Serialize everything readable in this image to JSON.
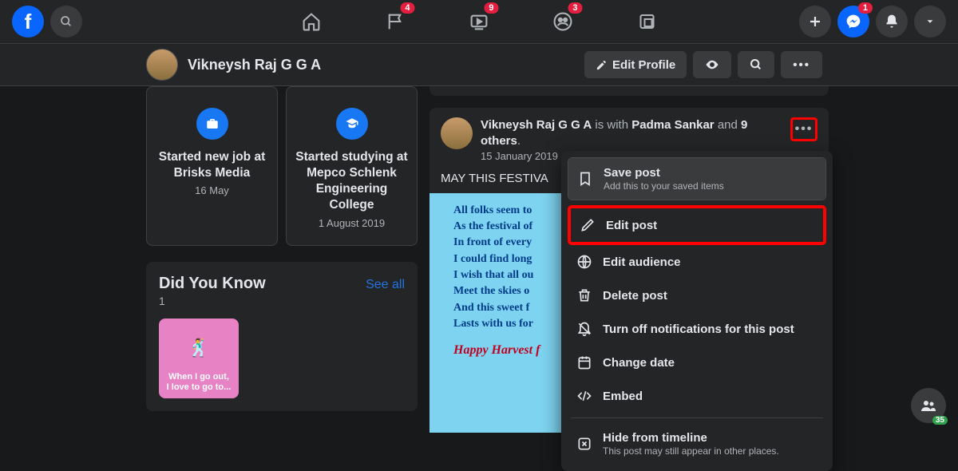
{
  "topnav": {
    "flags_badge": "4",
    "watch_badge": "9",
    "groups_badge": "3",
    "messenger_badge": "1"
  },
  "profile": {
    "name": "Vikneysh Raj G G A",
    "edit_label": "Edit Profile"
  },
  "life_events": [
    {
      "title": "Started new job at Brisks Media",
      "date": "16 May"
    },
    {
      "title": "Started studying at Mepco Schlenk Engineering College",
      "date": "1 August 2019"
    }
  ],
  "dyk": {
    "title": "Did You Know",
    "count": "1",
    "see_all": "See all",
    "card_line1": "When I go out,",
    "card_line2": "I love to go to..."
  },
  "post": {
    "author": "Vikneysh Raj G G A",
    "is_with": "is with",
    "tagged": "Padma Sankar",
    "and": "and",
    "others": "9 others",
    "dot": ".",
    "date": "15 January 2019",
    "text": "MAY THIS FESTIVA",
    "poem": "All folks seem to\nAs the festival of\nIn front of every\nI could find long\nI wish that all ou\nMeet the skies o\nAnd this sweet f\nLasts with us for",
    "happy": "Happy Harvest f"
  },
  "menu": {
    "save": {
      "label": "Save post",
      "sub": "Add this to your saved items"
    },
    "edit": {
      "label": "Edit post"
    },
    "audience": {
      "label": "Edit audience"
    },
    "delete": {
      "label": "Delete post"
    },
    "notifications": {
      "label": "Turn off notifications for this post"
    },
    "date": {
      "label": "Change date"
    },
    "embed": {
      "label": "Embed"
    },
    "hide": {
      "label": "Hide from timeline",
      "sub": "This post may still appear in other places."
    }
  },
  "floating": {
    "count": "35"
  }
}
